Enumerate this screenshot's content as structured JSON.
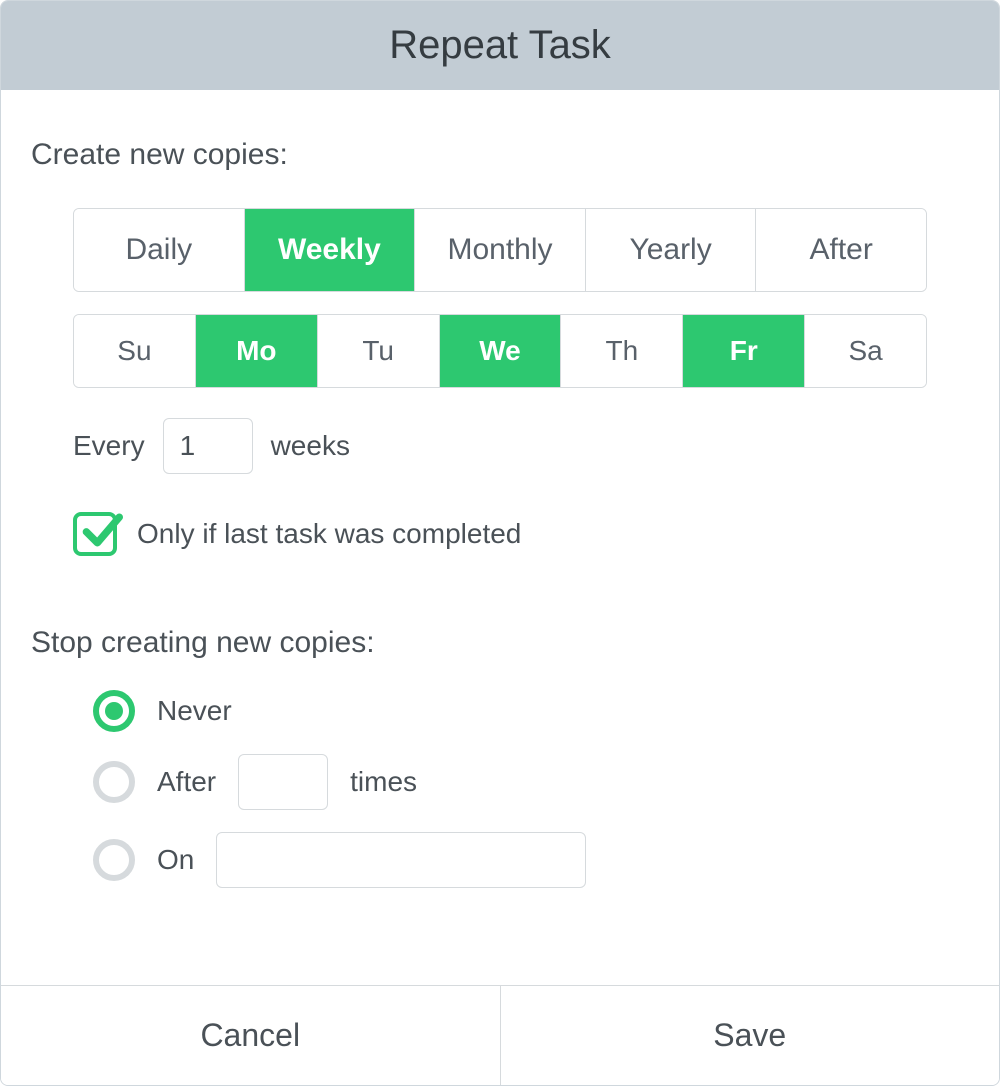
{
  "header": {
    "title": "Repeat Task"
  },
  "create": {
    "label": "Create new copies:",
    "frequency": [
      {
        "label": "Daily",
        "active": false
      },
      {
        "label": "Weekly",
        "active": true
      },
      {
        "label": "Monthly",
        "active": false
      },
      {
        "label": "Yearly",
        "active": false
      },
      {
        "label": "After",
        "active": false
      }
    ],
    "days": [
      {
        "label": "Su",
        "active": false
      },
      {
        "label": "Mo",
        "active": true
      },
      {
        "label": "Tu",
        "active": false
      },
      {
        "label": "We",
        "active": true
      },
      {
        "label": "Th",
        "active": false
      },
      {
        "label": "Fr",
        "active": true
      },
      {
        "label": "Sa",
        "active": false
      }
    ],
    "every": {
      "prefix": "Every",
      "value": "1",
      "suffix": "weeks"
    },
    "only_if": {
      "checked": true,
      "label": "Only if last task was completed"
    }
  },
  "stop": {
    "label": "Stop creating new copies:",
    "options": {
      "never": {
        "label": "Never",
        "selected": true
      },
      "after": {
        "label_prefix": "After",
        "value": "",
        "label_suffix": "times",
        "selected": false
      },
      "on": {
        "label": "On",
        "value": "",
        "selected": false
      }
    }
  },
  "footer": {
    "cancel": "Cancel",
    "save": "Save"
  },
  "colors": {
    "accent": "#2dc870",
    "header_bg": "#c2ccd4",
    "border": "#d6dadd",
    "text": "#4a5157"
  }
}
